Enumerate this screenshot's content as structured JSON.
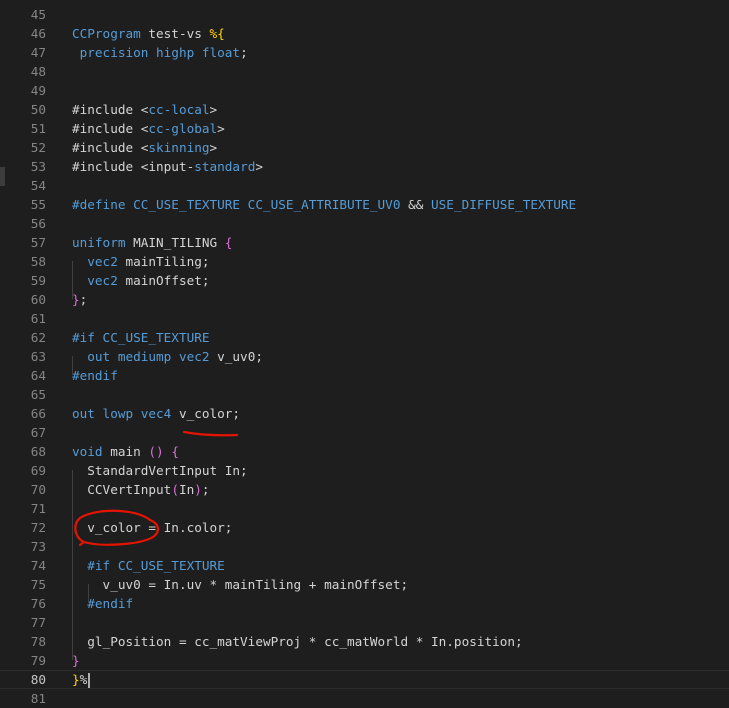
{
  "colors": {
    "background": "#1e1e1e",
    "line_number": "#858585",
    "keyword": "#569cd6",
    "preprocessor": "#c586c0",
    "function": "#dcdcaa",
    "string": "#ce9178",
    "variable": "#9cdcfe",
    "bracket_gold": "#ffd700",
    "bracket_orchid": "#da70d6",
    "annotation_ink": "#e51400"
  },
  "editor": {
    "current_line": 80,
    "lines": [
      {
        "n": "45",
        "tokens": []
      },
      {
        "n": "46",
        "tokens": [
          {
            "t": "CCProgram",
            "c": "kw"
          },
          {
            "t": " test-vs ",
            "c": "plain"
          },
          {
            "t": "%{",
            "c": "br1"
          }
        ]
      },
      {
        "n": "47",
        "tokens": [
          {
            "t": " precision highp float",
            "c": "kw"
          },
          {
            "t": ";",
            "c": "plain"
          }
        ]
      },
      {
        "n": "48",
        "tokens": []
      },
      {
        "n": "49",
        "tokens": []
      },
      {
        "n": "50",
        "tokens": [
          {
            "t": "#include ",
            "c": "plain"
          },
          {
            "t": "<",
            "c": "plain"
          },
          {
            "t": "cc-local",
            "c": "kw"
          },
          {
            "t": ">",
            "c": "plain"
          }
        ]
      },
      {
        "n": "51",
        "tokens": [
          {
            "t": "#include ",
            "c": "plain"
          },
          {
            "t": "<",
            "c": "plain"
          },
          {
            "t": "cc-global",
            "c": "kw"
          },
          {
            "t": ">",
            "c": "plain"
          }
        ]
      },
      {
        "n": "52",
        "tokens": [
          {
            "t": "#include ",
            "c": "plain"
          },
          {
            "t": "<",
            "c": "plain"
          },
          {
            "t": "skinning",
            "c": "kw"
          },
          {
            "t": ">",
            "c": "plain"
          }
        ]
      },
      {
        "n": "53",
        "tokens": [
          {
            "t": "#include ",
            "c": "plain"
          },
          {
            "t": "<input-",
            "c": "plain"
          },
          {
            "t": "standard",
            "c": "kw"
          },
          {
            "t": ">",
            "c": "plain"
          }
        ]
      },
      {
        "n": "54",
        "tokens": []
      },
      {
        "n": "55",
        "tokens": [
          {
            "t": "#define CC_USE_TEXTURE CC_USE_ATTRIBUTE_UV0 ",
            "c": "kw"
          },
          {
            "t": "&&",
            "c": "plain"
          },
          {
            "t": " USE_DIFFUSE_TEXTURE",
            "c": "kw"
          }
        ]
      },
      {
        "n": "56",
        "tokens": []
      },
      {
        "n": "57",
        "tokens": [
          {
            "t": "uniform",
            "c": "kw"
          },
          {
            "t": " MAIN_TILING ",
            "c": "plain"
          },
          {
            "t": "{",
            "c": "br2"
          }
        ]
      },
      {
        "n": "58",
        "tokens": [
          {
            "t": "  vec2",
            "c": "kw"
          },
          {
            "t": " mainTiling;",
            "c": "plain"
          }
        ]
      },
      {
        "n": "59",
        "tokens": [
          {
            "t": "  vec2",
            "c": "kw"
          },
          {
            "t": " mainOffset;",
            "c": "plain"
          }
        ]
      },
      {
        "n": "60",
        "tokens": [
          {
            "t": "}",
            "c": "br2"
          },
          {
            "t": ";",
            "c": "plain"
          }
        ]
      },
      {
        "n": "61",
        "tokens": []
      },
      {
        "n": "62",
        "tokens": [
          {
            "t": "#if CC_USE_TEXTURE",
            "c": "kw"
          }
        ]
      },
      {
        "n": "63",
        "tokens": [
          {
            "t": "  out mediump vec2",
            "c": "kw"
          },
          {
            "t": " v_uv0;",
            "c": "plain"
          }
        ]
      },
      {
        "n": "64",
        "tokens": [
          {
            "t": "#endif",
            "c": "kw"
          }
        ]
      },
      {
        "n": "65",
        "tokens": []
      },
      {
        "n": "66",
        "tokens": [
          {
            "t": "out lowp vec4",
            "c": "kw"
          },
          {
            "t": " v_color;",
            "c": "plain"
          }
        ]
      },
      {
        "n": "67",
        "tokens": []
      },
      {
        "n": "68",
        "tokens": [
          {
            "t": "void",
            "c": "kw"
          },
          {
            "t": " main ",
            "c": "plain"
          },
          {
            "t": "()",
            "c": "br2"
          },
          {
            "t": " ",
            "c": "plain"
          },
          {
            "t": "{",
            "c": "br2"
          }
        ]
      },
      {
        "n": "69",
        "tokens": [
          {
            "t": "  StandardVertInput In;",
            "c": "plain"
          }
        ]
      },
      {
        "n": "70",
        "tokens": [
          {
            "t": "  CCVertInput",
            "c": "plain"
          },
          {
            "t": "(",
            "c": "br2"
          },
          {
            "t": "In",
            "c": "plain"
          },
          {
            "t": ")",
            "c": "br2"
          },
          {
            "t": ";",
            "c": "plain"
          }
        ]
      },
      {
        "n": "71",
        "tokens": []
      },
      {
        "n": "72",
        "tokens": [
          {
            "t": "  v_color = In.color;",
            "c": "plain"
          }
        ]
      },
      {
        "n": "73",
        "tokens": []
      },
      {
        "n": "74",
        "tokens": [
          {
            "t": "  #if CC_USE_TEXTURE",
            "c": "kw"
          }
        ]
      },
      {
        "n": "75",
        "tokens": [
          {
            "t": "    v_uv0 = In.uv * mainTiling + mainOffset;",
            "c": "plain"
          }
        ]
      },
      {
        "n": "76",
        "tokens": [
          {
            "t": "  #endif",
            "c": "kw"
          }
        ]
      },
      {
        "n": "77",
        "tokens": []
      },
      {
        "n": "78",
        "tokens": [
          {
            "t": "  gl_Position = cc_matViewProj * cc_matWorld * In.position;",
            "c": "plain"
          }
        ]
      },
      {
        "n": "79",
        "tokens": [
          {
            "t": "}",
            "c": "br2"
          }
        ]
      },
      {
        "n": "80",
        "tokens": [
          {
            "t": "}",
            "c": "br1"
          },
          {
            "t": "%",
            "c": "plain"
          }
        ]
      },
      {
        "n": "81",
        "tokens": []
      }
    ]
  }
}
